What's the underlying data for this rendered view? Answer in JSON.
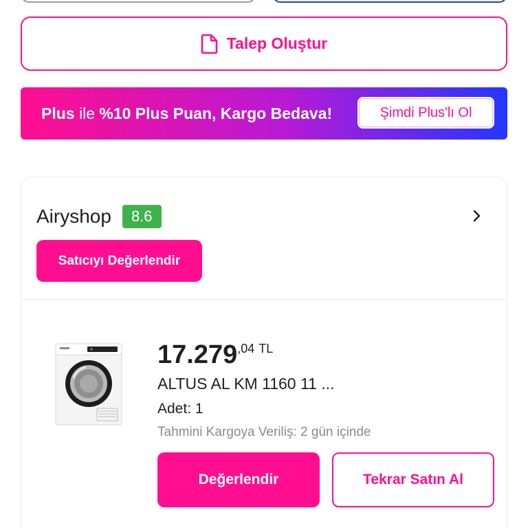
{
  "talep_button": {
    "label": "Talep Oluştur",
    "icon": "document-icon"
  },
  "plus_banner": {
    "text_bold_1": "Plus",
    "text_regular": " ile ",
    "text_bold_2": "%10 Plus Puan, Kargo Bedava!",
    "cta_label": "Şimdi Plus'lı Ol"
  },
  "seller": {
    "name": "Airyshop",
    "score": "8.6",
    "rate_button_label": "Satıcıyı Değerlendir"
  },
  "product": {
    "price_integer": "17.279",
    "price_decimal": ",04",
    "currency": "TL",
    "name": "ALTUS AL KM 1160 11 ...",
    "quantity_label": "Adet: 1",
    "shipping_estimate": "Tahmini Kargoya Veriliş: 2 gün içinde",
    "rate_button_label": "Değerlendir",
    "rebuy_button_label": "Tekrar Satın Al"
  },
  "colors": {
    "accent": "#ff0f8f",
    "score_badge": "#3fb34b",
    "banner_gradient_start": "#ff0f8f",
    "banner_gradient_end": "#2437ff"
  }
}
